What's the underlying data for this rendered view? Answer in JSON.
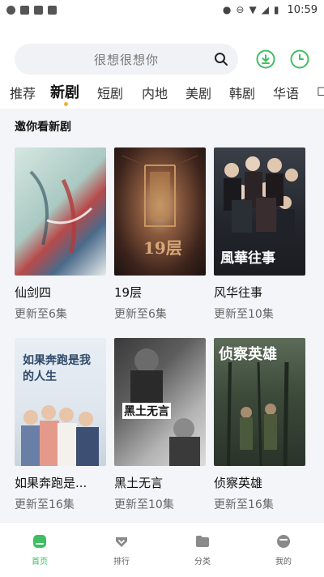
{
  "status_bar": {
    "time": "10:59"
  },
  "search": {
    "placeholder": "很想很想你"
  },
  "tabs": [
    "推荐",
    "新剧",
    "短剧",
    "内地",
    "美剧",
    "韩剧",
    "华语"
  ],
  "active_tab_index": 1,
  "section": {
    "title": "邀你看新剧"
  },
  "cards": [
    {
      "title": "仙剑四",
      "subtitle": "更新至6集",
      "poster_color": "#c9dbd6"
    },
    {
      "title": "19层",
      "subtitle": "更新至6集",
      "poster_color": "#5a3a2e"
    },
    {
      "title": "风华往事",
      "subtitle": "更新至10集",
      "poster_color": "#2a2e35"
    },
    {
      "title": "如果奔跑是...",
      "subtitle": "更新至16集",
      "poster_color": "#dfe6ee"
    },
    {
      "title": "黑土无言",
      "subtitle": "更新至10集",
      "poster_color": "#8e8e8e"
    },
    {
      "title": "侦察英雄",
      "subtitle": "更新至16集",
      "poster_color": "#3c4a3a"
    }
  ],
  "poster_text": {
    "card2": "19层",
    "card3": "風華往事",
    "card4": "如果奔跑是我的人生",
    "card5": "黑土无言",
    "card6": "侦察英雄"
  },
  "bottom_nav": [
    {
      "label": "首页",
      "icon": "home-icon",
      "active": true
    },
    {
      "label": "排行",
      "icon": "ranking-icon",
      "active": false
    },
    {
      "label": "分类",
      "icon": "category-icon",
      "active": false
    },
    {
      "label": "我的",
      "icon": "profile-icon",
      "active": false
    }
  ],
  "colors": {
    "accent": "#3fbf62",
    "tab_dot": "#f2b232",
    "content_bg": "#f4f5f8"
  }
}
